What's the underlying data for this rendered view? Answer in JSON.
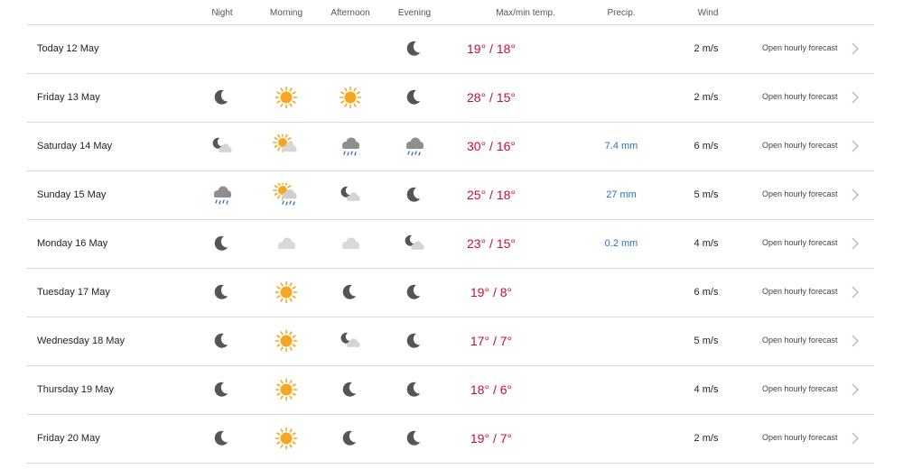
{
  "columns": {
    "night": "Night",
    "morning": "Morning",
    "afternoon": "Afternoon",
    "evening": "Evening",
    "temp": "Max/min temp.",
    "precip": "Precip.",
    "wind": "Wind"
  },
  "colors": {
    "temp": "#c8102e",
    "precip": "#2a72c0",
    "moon": "#555555",
    "sun": "#f5a623",
    "cloud": "#cfcfcf"
  },
  "rows": [
    {
      "day": "Today 12 May",
      "icons": [
        "",
        "",
        "",
        "moon"
      ],
      "temp": "19° / 18°",
      "precip": "",
      "wind": "2 m/s",
      "link": "Open hourly forecast"
    },
    {
      "day": "Friday 13 May",
      "icons": [
        "moon",
        "sun",
        "sun",
        "moon"
      ],
      "temp": "28° / 15°",
      "precip": "",
      "wind": "2 m/s",
      "link": "Open hourly forecast"
    },
    {
      "day": "Saturday 14 May",
      "icons": [
        "moon-cloud",
        "sun-cloud",
        "rain-cloud",
        "rain-cloud"
      ],
      "temp": "30° / 16°",
      "precip": "7.4 mm",
      "wind": "6 m/s",
      "link": "Open hourly forecast"
    },
    {
      "day": "Sunday 15 May",
      "icons": [
        "rain-cloud",
        "sun-rain",
        "moon-cloud",
        "moon"
      ],
      "temp": "25° / 18°",
      "precip": "27 mm",
      "wind": "5 m/s",
      "link": "Open hourly forecast"
    },
    {
      "day": "Monday 16 May",
      "icons": [
        "moon",
        "cloud",
        "cloud",
        "moon-cloud"
      ],
      "temp": "23° / 15°",
      "precip": "0.2 mm",
      "wind": "4 m/s",
      "link": "Open hourly forecast"
    },
    {
      "day": "Tuesday 17 May",
      "icons": [
        "moon",
        "sun",
        "moon",
        "moon"
      ],
      "temp": "19° / 8°",
      "precip": "",
      "wind": "6 m/s",
      "link": "Open hourly forecast"
    },
    {
      "day": "Wednesday 18 May",
      "icons": [
        "moon",
        "sun",
        "moon-cloud",
        "moon"
      ],
      "temp": "17° / 7°",
      "precip": "",
      "wind": "5 m/s",
      "link": "Open hourly forecast"
    },
    {
      "day": "Thursday 19 May",
      "icons": [
        "moon",
        "sun",
        "moon",
        "moon"
      ],
      "temp": "18° / 6°",
      "precip": "",
      "wind": "4 m/s",
      "link": "Open hourly forecast"
    },
    {
      "day": "Friday 20 May",
      "icons": [
        "moon",
        "sun",
        "moon",
        "moon"
      ],
      "temp": "19° / 7°",
      "precip": "",
      "wind": "2 m/s",
      "link": "Open hourly forecast"
    }
  ]
}
